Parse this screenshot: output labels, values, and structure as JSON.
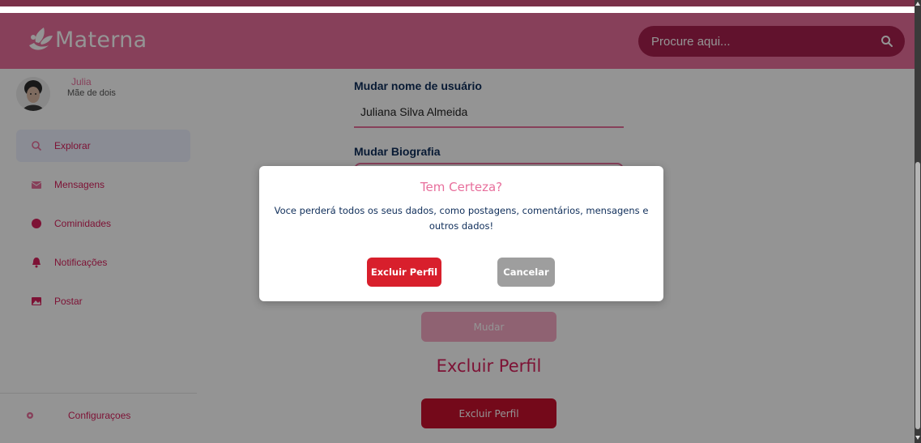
{
  "header": {
    "logo_text": "Materna",
    "search_placeholder": "Procure aqui..."
  },
  "profile": {
    "name": "Julia",
    "bio": "Mãe de dois"
  },
  "sidebar": {
    "items": [
      {
        "label": "Explorar",
        "icon": "search-icon"
      },
      {
        "label": "Mensagens",
        "icon": "envelope-icon"
      },
      {
        "label": "Cominidades",
        "icon": "globe-icon"
      },
      {
        "label": "Notificações",
        "icon": "bell-icon"
      },
      {
        "label": "Postar",
        "icon": "image-icon"
      }
    ],
    "settings_label": "Configuraçoes"
  },
  "main": {
    "username_label": "Mudar nome de usuário",
    "username_value": "Juliana Silva Almeida",
    "bio_label": "Mudar Biografia",
    "mudar_button": "Mudar",
    "delete_section_title": "Excluir Perfil",
    "delete_button": "Excluir Perfil"
  },
  "modal": {
    "title": "Tem Certeza?",
    "message": "Voce perderá todos os seus dados, como postagens, comentários, mensagens e outros dados!",
    "confirm_button": "Excluir Perfil",
    "cancel_button": "Cancelar"
  },
  "colors": {
    "brand_pink": "#e86f9c",
    "accent_red": "#d81f5c",
    "danger": "#c8102e"
  }
}
